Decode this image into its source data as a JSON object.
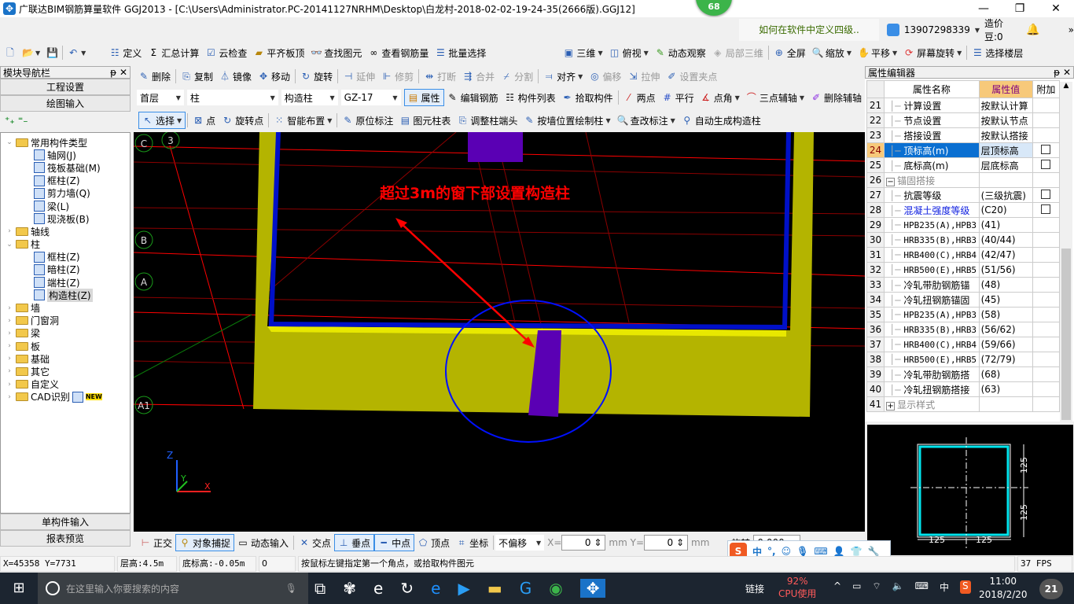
{
  "window": {
    "title": "广联达BIM钢筋算量软件 GGJ2013 - [C:\\Users\\Administrator.PC-20141127NRHM\\Desktop\\白龙村-2018-02-02-19-24-35(2666版).GGJ12]",
    "badge": "68",
    "minimize": "—",
    "restore": "❐",
    "close": "✕"
  },
  "header": {
    "hint": "如何在软件中定义四级..",
    "user": "13907298339",
    "beans": "造价豆:0",
    "more": "»"
  },
  "toolbar1": {
    "items": [
      "定义",
      "汇总计算",
      "云检查",
      "平齐板顶",
      "查找图元",
      "查看钢筋量",
      "批量选择",
      "三维",
      "俯视",
      "动态观察",
      "局部三维",
      "全屏",
      "缩放",
      "平移",
      "屏幕旋转",
      "选择楼层"
    ]
  },
  "toolbar2": {
    "items": [
      "删除",
      "复制",
      "镜像",
      "移动",
      "旋转",
      "延伸",
      "修剪",
      "打断",
      "合并",
      "分割",
      "对齐",
      "偏移",
      "拉伸",
      "设置夹点"
    ]
  },
  "toolbar3": {
    "floor": "首层",
    "category": "柱",
    "type": "构造柱",
    "component": "GZ-17",
    "items": [
      "属性",
      "编辑钢筋",
      "构件列表",
      "拾取构件",
      "两点",
      "平行",
      "点角",
      "三点辅轴",
      "删除辅轴"
    ]
  },
  "toolbar4": {
    "items": [
      "选择",
      "点",
      "旋转点",
      "智能布置",
      "原位标注",
      "图元柱表",
      "调整柱端头",
      "按墙位置绘制柱",
      "查改标注",
      "自动生成构造柱"
    ]
  },
  "nav": {
    "title": "模块导航栏",
    "top_buttons": [
      "工程设置",
      "绘图输入"
    ],
    "bottom_buttons": [
      "单构件输入",
      "报表预览"
    ],
    "tree": [
      {
        "label": "常用构件类型",
        "level": 0,
        "expanded": true
      },
      {
        "label": "轴网(J)",
        "level": 1
      },
      {
        "label": "筏板基础(M)",
        "level": 1
      },
      {
        "label": "框柱(Z)",
        "level": 1
      },
      {
        "label": "剪力墙(Q)",
        "level": 1
      },
      {
        "label": "梁(L)",
        "level": 1
      },
      {
        "label": "现浇板(B)",
        "level": 1
      },
      {
        "label": "轴线",
        "level": 0
      },
      {
        "label": "柱",
        "level": 0,
        "expanded": true
      },
      {
        "label": "框柱(Z)",
        "level": 1
      },
      {
        "label": "暗柱(Z)",
        "level": 1
      },
      {
        "label": "端柱(Z)",
        "level": 1
      },
      {
        "label": "构造柱(Z)",
        "level": 1,
        "selected": true
      },
      {
        "label": "墙",
        "level": 0
      },
      {
        "label": "门窗洞",
        "level": 0
      },
      {
        "label": "梁",
        "level": 0
      },
      {
        "label": "板",
        "level": 0
      },
      {
        "label": "基础",
        "level": 0
      },
      {
        "label": "其它",
        "level": 0
      },
      {
        "label": "自定义",
        "level": 0
      },
      {
        "label": "CAD识别",
        "level": 0,
        "badge": "NEW"
      }
    ]
  },
  "canvas": {
    "annotation": "超过3m的窗下部设置构造柱",
    "axis_labels": [
      "C",
      "3",
      "B",
      "A",
      "A1"
    ],
    "axes": {
      "z": "Z",
      "y": "Y",
      "x": "X"
    }
  },
  "bottom_toolbar": {
    "items": [
      "正交",
      "对象捕捉",
      "动态输入",
      "交点",
      "垂点",
      "中点",
      "顶点",
      "坐标"
    ],
    "offset_mode": "不偏移",
    "x_label": "X=",
    "x_value": "0",
    "y_label": "Y=",
    "y_value": "0",
    "unit": "mm",
    "rotate_label": "旋转",
    "rotate_value": "0.000"
  },
  "props": {
    "title": "属性编辑器",
    "headers": [
      "属性名称",
      "属性值",
      "附加"
    ],
    "rows": [
      {
        "n": "21",
        "name": "计算设置",
        "value": "按默认计算",
        "check": false
      },
      {
        "n": "22",
        "name": "节点设置",
        "value": "按默认节点",
        "check": false
      },
      {
        "n": "23",
        "name": "搭接设置",
        "value": "按默认搭接",
        "check": false
      },
      {
        "n": "24",
        "name": "顶标高(m)",
        "value": "层顶标高",
        "check": true,
        "highlight": true
      },
      {
        "n": "25",
        "name": "底标高(m)",
        "value": "层底标高",
        "check": true
      },
      {
        "n": "26",
        "name": "锚固搭接",
        "value": "",
        "group": "−"
      },
      {
        "n": "27",
        "name": "抗震等级",
        "value": "(三级抗震)",
        "check": true
      },
      {
        "n": "28",
        "name": "混凝土强度等级",
        "value": "(C20)",
        "check": true,
        "blue": true
      },
      {
        "n": "29",
        "name": "HPB235(A),HPB3",
        "value": "(41)"
      },
      {
        "n": "30",
        "name": "HRB335(B),HRB3",
        "value": "(40/44)"
      },
      {
        "n": "31",
        "name": "HRB400(C),HRB4",
        "value": "(42/47)"
      },
      {
        "n": "32",
        "name": "HRB500(E),HRB5",
        "value": "(51/56)"
      },
      {
        "n": "33",
        "name": "冷轧带肋钢筋锚",
        "value": "(48)"
      },
      {
        "n": "34",
        "name": "冷轧扭钢筋锚固",
        "value": "(45)"
      },
      {
        "n": "35",
        "name": "HPB235(A),HPB3",
        "value": "(58)"
      },
      {
        "n": "36",
        "name": "HRB335(B),HRB3",
        "value": "(56/62)"
      },
      {
        "n": "37",
        "name": "HRB400(C),HRB4",
        "value": "(59/66)"
      },
      {
        "n": "38",
        "name": "HRB500(E),HRB5",
        "value": "(72/79)"
      },
      {
        "n": "39",
        "name": "冷轧带肋钢筋搭",
        "value": "(68)"
      },
      {
        "n": "40",
        "name": "冷轧扭钢筋搭接",
        "value": "(63)"
      },
      {
        "n": "41",
        "name": "显示样式",
        "value": "",
        "group": "+"
      }
    ]
  },
  "preview": {
    "dims": [
      "125",
      "125",
      "125",
      "125"
    ]
  },
  "status": {
    "coords": "X=45358 Y=7731",
    "floor_height": "层高:4.5m",
    "base_elev": "底标高:-0.05m",
    "count": "0",
    "prompt": "按鼠标左键指定第一个角点，或拾取构件图元",
    "fps": "37 FPS"
  },
  "ime": {
    "lang": "中",
    "punct": "°,"
  },
  "taskbar": {
    "search_placeholder": "在这里输入你要搜索的内容",
    "link": "链接",
    "cpu": "92%",
    "cpu_label": "CPU使用",
    "ime_lang": "中",
    "time": "11:00",
    "date": "2018/2/20",
    "notifications": "21"
  },
  "colors": {
    "wall": "#b4b400",
    "column": "#5a00b4",
    "axis_red": "#ff0000",
    "highlight": "#0a6fd1",
    "annotation": "#ff0000"
  }
}
